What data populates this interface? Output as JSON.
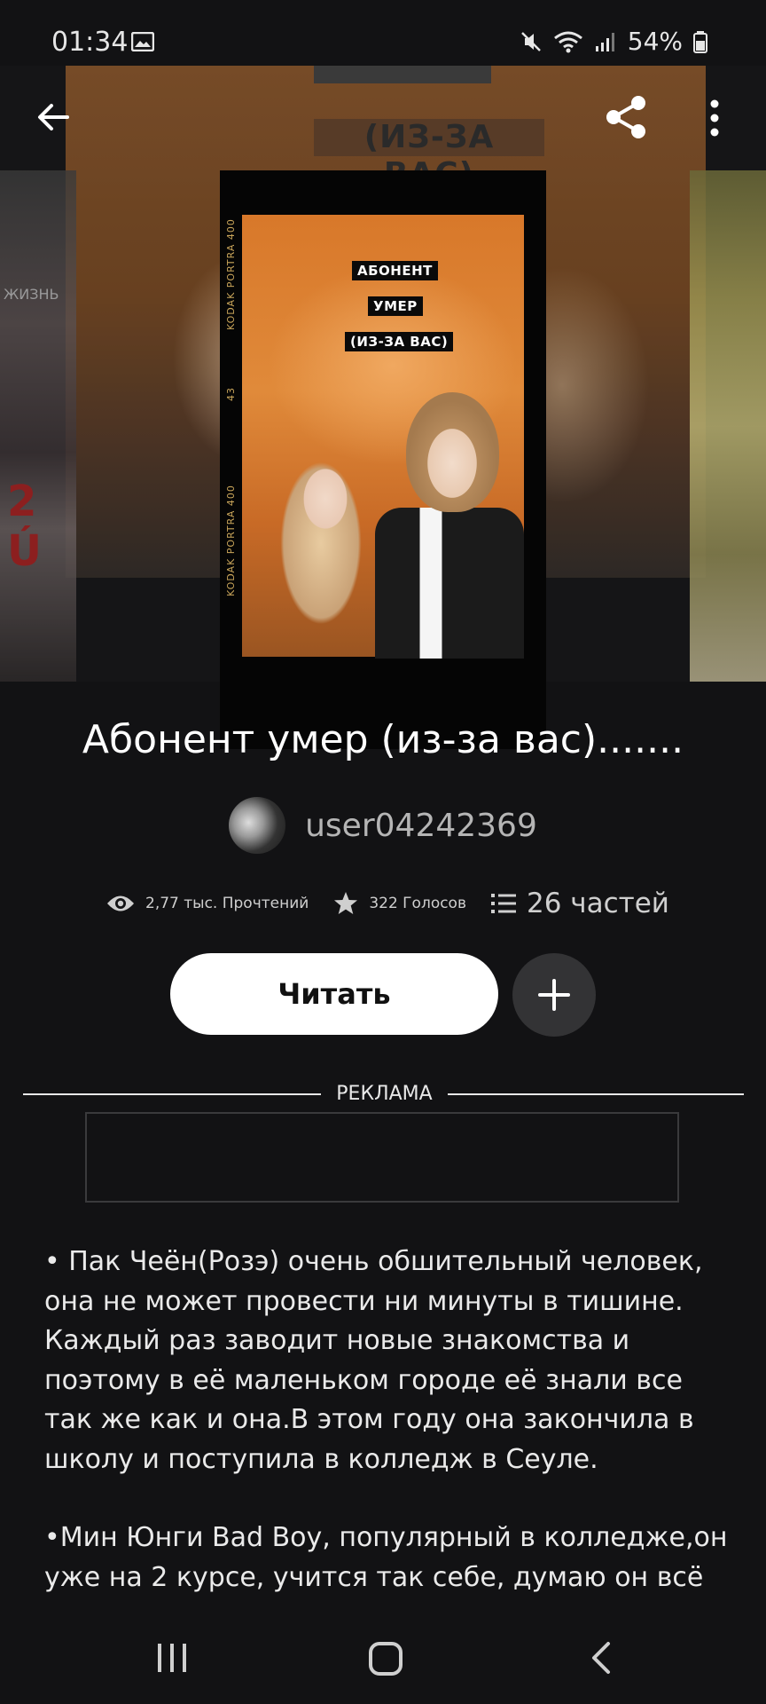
{
  "status_bar": {
    "time": "01:34",
    "battery": "54%"
  },
  "hero": {
    "bg_text": "(ИЗ-ЗА ВАС)",
    "left_text": "ЖИЗНЬ",
    "cover_kodak": "KODAK PORTRA 400",
    "cover_number": "43",
    "cover_lines": [
      "АБОНЕНТ",
      "УМЕР",
      "(ИЗ-ЗА ВАС)"
    ]
  },
  "story": {
    "title": "Абонент умер (из-за вас).......",
    "author": "user04242369",
    "reads": "2,77 тыс. Прочтений",
    "votes": "322 Голосов",
    "parts": "26 частей",
    "read_button": "Читать"
  },
  "ad": {
    "label": "РЕКЛАМА"
  },
  "description": {
    "paragraph1": "• Пак Чеён(Розэ) очень обшительный человек, она не может провести ни минуты в тишине. Каждый раз заводит новые знакомства и поэтому в её маленьком городе её знали все так же как и она.В этом году она закончила в школу и поступила в колледж в Сеуле.",
    "paragraph2": "•Мин Юнги Bad Boy, популярный в колледже,он уже на 2 курсе, учится так себе, думаю он всё"
  },
  "icons": {
    "back": "arrow-left-icon",
    "share": "share-icon",
    "more": "more-vertical-icon",
    "reads": "eye-icon",
    "votes": "star-icon",
    "parts": "list-icon",
    "add": "plus-icon"
  }
}
